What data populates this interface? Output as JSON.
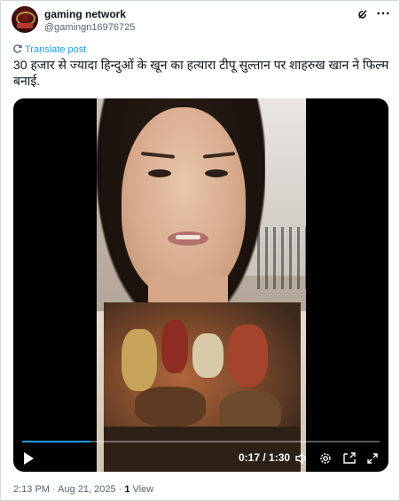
{
  "author": {
    "name": "gaming network",
    "handle": "@gamingn16976725",
    "avatar_icon": "crown-logo-avatar"
  },
  "translate_label": "Translate post",
  "tweet_text": "30 हजार से ज्यादा हिन्दुओं के खून का हत्यारा टीपू सुल्तान पर शाहरुख खान ने  फिल्म बनाई.",
  "video": {
    "time": "0:17 / 1:30",
    "progress": 0.19,
    "icons": [
      "play-icon",
      "volume-icon",
      "settings-icon",
      "pip-icon",
      "fullscreen-icon"
    ]
  },
  "meta": {
    "time_date": "2:13 PM · Aug 21, 2025 · ",
    "views_count": "1",
    "views_label": " View"
  },
  "colors": {
    "accent": "#1d9bf0",
    "muted": "#536471",
    "text": "#0f1419"
  }
}
